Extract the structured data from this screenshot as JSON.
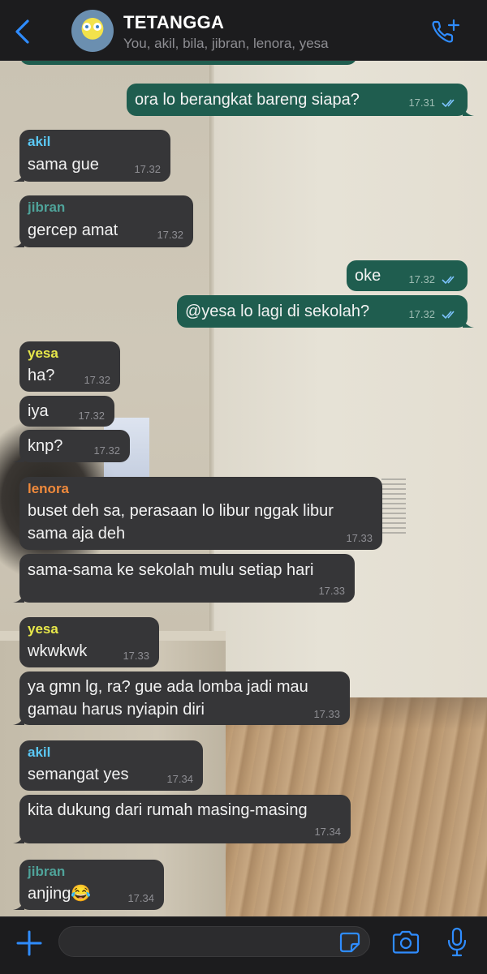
{
  "header": {
    "title": "TETANGGA",
    "members": "You, akil, bila, jibran, lenora, yesa",
    "accent": "#2f8cff"
  },
  "partial_time": "17.31",
  "messages": [
    {
      "dir": "out",
      "text": "ora lo berangkat bareng siapa?",
      "time": "17.31",
      "read": true
    },
    {
      "dir": "in",
      "sender": "akil",
      "sender_color": "#5bc8f5",
      "text": "sama gue",
      "time": "17.32"
    },
    {
      "dir": "in",
      "sender": "jibran",
      "sender_color": "#4fa39a",
      "text": "gercep amat",
      "time": "17.32"
    },
    {
      "dir": "out",
      "text": "oke",
      "time": "17.32",
      "read": true
    },
    {
      "dir": "out",
      "text": "@yesa lo lagi di sekolah?",
      "time": "17.32",
      "read": true
    },
    {
      "dir": "in",
      "sender": "yesa",
      "sender_color": "#e8e84a",
      "text": "ha?",
      "time": "17.32"
    },
    {
      "dir": "in",
      "text": "iya",
      "time": "17.32"
    },
    {
      "dir": "in",
      "text": "knp?",
      "time": "17.32"
    },
    {
      "dir": "in",
      "sender": "lenora",
      "sender_color": "#f08a3c",
      "text_lines": [
        "buset deh sa, perasaan lo libur nggak libur",
        "sama aja deh"
      ],
      "time": "17.33"
    },
    {
      "dir": "in",
      "text": "sama-sama ke sekolah mulu setiap hari",
      "time": "17.33"
    },
    {
      "dir": "in",
      "sender": "yesa",
      "sender_color": "#e8e84a",
      "text": "wkwkwk",
      "time": "17.33"
    },
    {
      "dir": "in",
      "text_lines": [
        "ya gmn lg, ra? gue ada lomba jadi mau",
        "gamau harus nyiapin diri"
      ],
      "time": "17.33"
    },
    {
      "dir": "in",
      "sender": "akil",
      "sender_color": "#5bc8f5",
      "text": "semangat yes",
      "time": "17.34"
    },
    {
      "dir": "in",
      "text": "kita dukung dari rumah masing-masing",
      "time": "17.34"
    },
    {
      "dir": "in",
      "sender": "jibran",
      "sender_color": "#4fa39a",
      "text": "anjing😂",
      "time": "17.34"
    }
  ],
  "icons": {
    "back": "chevron-left-icon",
    "call": "add-call-icon",
    "plus": "plus-icon",
    "sticker": "sticker-icon",
    "camera": "camera-icon",
    "mic": "microphone-icon"
  }
}
